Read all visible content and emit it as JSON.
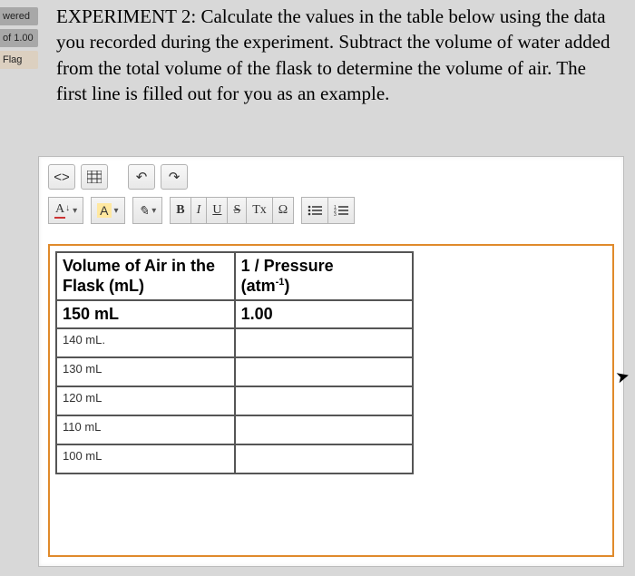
{
  "sidebar": {
    "items": [
      {
        "label": "wered"
      },
      {
        "label": "of 1.00"
      },
      {
        "label": "Flag"
      }
    ]
  },
  "instructions": {
    "text": "EXPERIMENT 2: Calculate the values in the table below using the data you recorded during the experiment. Subtract the volume of water added from the total volume of the flask to determine the volume of air. The first line is filled out for you as an example."
  },
  "toolbar": {
    "code": "<>",
    "table_btn": "⊞",
    "undo": "↶",
    "redo": "↷",
    "font_color": "A",
    "bg_color": "A",
    "brush": "✎",
    "bold": "B",
    "italic": "I",
    "underline": "U",
    "strike": "S",
    "clear": "Tx",
    "omega": "Ω",
    "list_ul": "≣",
    "list_ol": "≣"
  },
  "table": {
    "headers": {
      "col1_line1": "Volume of Air in the",
      "col1_line2": "Flask (mL)",
      "col2_line1": "1 / Pressure",
      "col2_line2_html": "(atm<sup>-1</sup>)"
    },
    "example": {
      "vol": "150 mL",
      "inv": "1.00"
    },
    "rows": [
      {
        "vol": "140 mL.",
        "inv": ""
      },
      {
        "vol": "130 mL",
        "inv": ""
      },
      {
        "vol": "120 mL",
        "inv": ""
      },
      {
        "vol": "110 mL",
        "inv": ""
      },
      {
        "vol": "100 mL",
        "inv": ""
      }
    ]
  }
}
